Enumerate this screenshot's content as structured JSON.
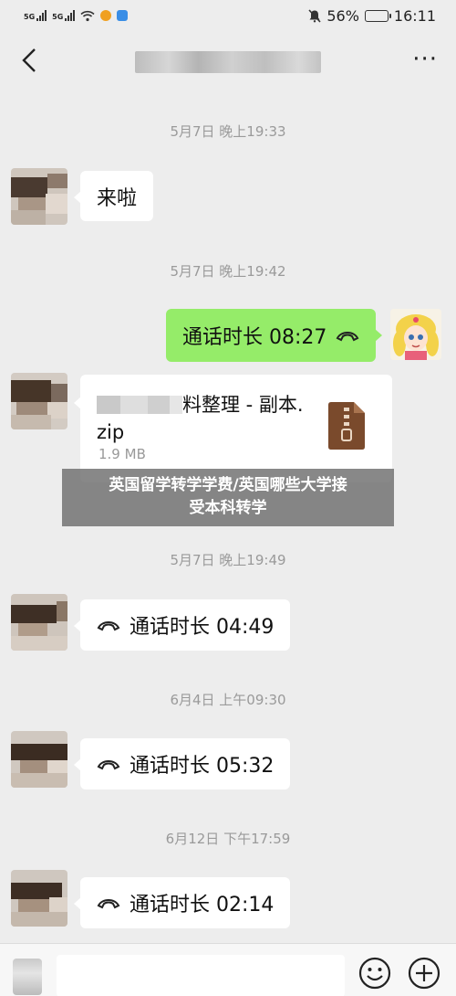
{
  "status_bar": {
    "signal_labels": [
      "5G",
      "5G"
    ],
    "battery": "56%",
    "battery_level": 0.56,
    "time": "16:11"
  },
  "header": {
    "back_icon": "chevron-left-icon",
    "more_label": "···"
  },
  "messages": {
    "ts1": "5月7日 晚上19:33",
    "msg1": "来啦",
    "ts2": "5月7日 晚上19:42",
    "call1": "通话时长 08:27",
    "file_name_line1": "料整理 - 副本.",
    "file_name_line2": "zip",
    "file_size": "1.9 MB",
    "ts3": "5月7日 晚上19:49",
    "call2": "通话时长 04:49",
    "ts4": "6月4日 上午09:30",
    "call3": "通话时长 05:32",
    "ts5": "6月12日 下午17:59",
    "call4": "通话时长 02:14"
  },
  "overlay": {
    "line1": "英国留学转学学费/英国哪些大学接",
    "line2": "受本科转学"
  },
  "colors": {
    "background": "#ededed",
    "green_bubble": "#95ec69",
    "timestamp": "#9a9a9a",
    "zip_brown": "#7a4a2c"
  }
}
